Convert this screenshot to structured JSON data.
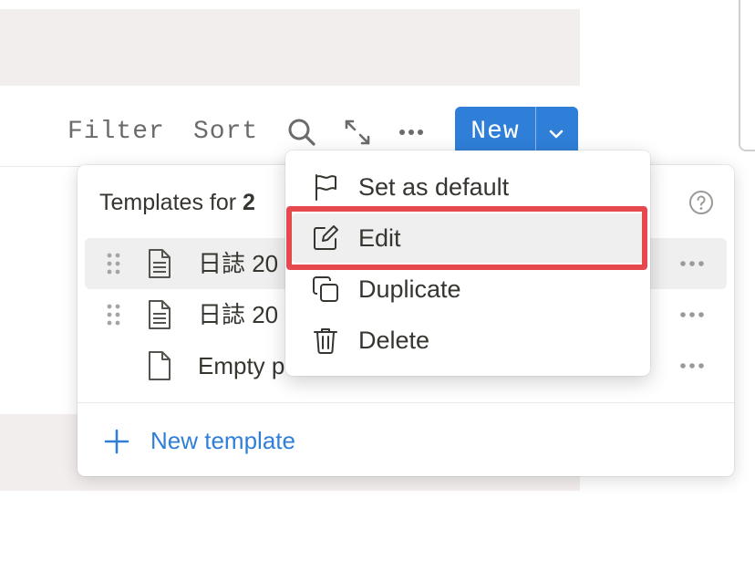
{
  "toolbar": {
    "filter_label": "Filter",
    "sort_label": "Sort",
    "icons": [
      "search-icon",
      "expand-icon",
      "more-icon"
    ],
    "new_label": "New",
    "accent_color": "#2f7fd9"
  },
  "templates_panel": {
    "title_prefix": "Templates for ",
    "title_bold": "2",
    "help_icon": "help-icon",
    "templates": [
      {
        "label": "日誌 20",
        "icon": "document-icon"
      },
      {
        "label": "日誌 20",
        "icon": "document-icon"
      },
      {
        "label": "Empty p",
        "icon": "blank-page-icon"
      }
    ],
    "new_template_label": "New template"
  },
  "context_menu": {
    "items": [
      {
        "label": "Set as default",
        "icon": "flag-icon"
      },
      {
        "label": "Edit",
        "icon": "edit-icon"
      },
      {
        "label": "Duplicate",
        "icon": "duplicate-icon"
      },
      {
        "label": "Delete",
        "icon": "trash-icon"
      }
    ],
    "highlight_color": "#e5484d"
  }
}
